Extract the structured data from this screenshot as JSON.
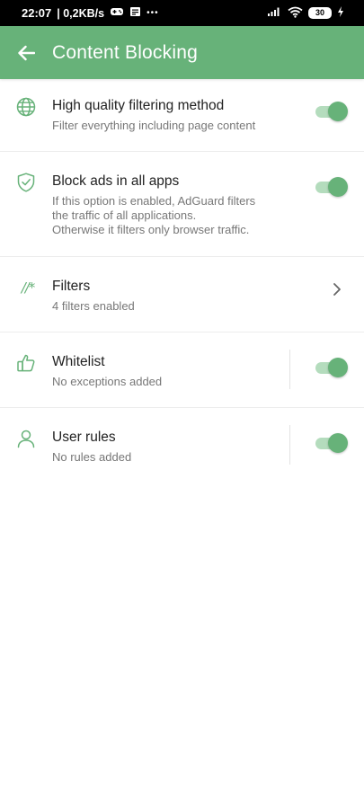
{
  "status_bar": {
    "time": "22:07",
    "speed": "| 0,2KB/s",
    "dots": "•••",
    "battery": "30"
  },
  "app_bar": {
    "title": "Content Blocking"
  },
  "rows": [
    {
      "title": "High quality filtering method",
      "subtitle": "Filter everything including page content",
      "icon": "globe-icon",
      "toggle_on": true
    },
    {
      "title": "Block ads in all apps",
      "subtitle_lines": [
        "If this option is enabled, AdGuard filters",
        "the traffic of all applications.",
        "Otherwise it filters only browser traffic."
      ],
      "icon": "shield-check-icon",
      "toggle_on": true
    },
    {
      "title": "Filters",
      "subtitle": "4 filters enabled",
      "icon": "filters-icon",
      "icon_text": "//*",
      "action": "chevron-right-icon"
    },
    {
      "title": "Whitelist",
      "subtitle": "No exceptions added",
      "icon": "thumbs-up-icon",
      "toggle_on": true
    },
    {
      "title": "User rules",
      "subtitle": "No rules added",
      "icon": "user-icon",
      "toggle_on": true
    }
  ],
  "colors": {
    "accent": "#67b279",
    "accent_light": "#b4dcbd",
    "status_bar": "#000000"
  }
}
